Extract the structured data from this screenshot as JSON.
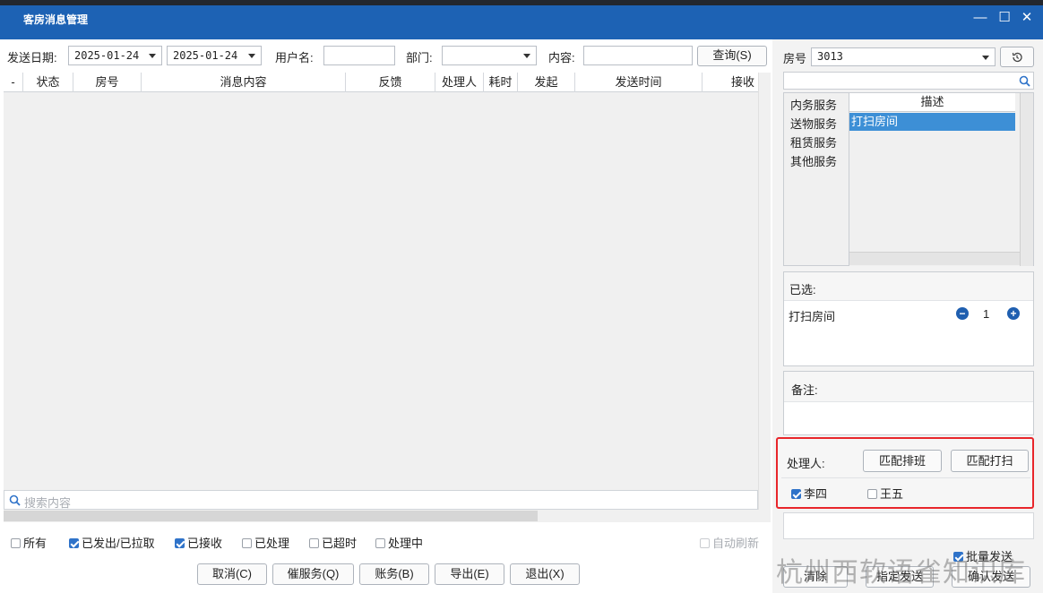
{
  "window": {
    "title": "客房消息管理",
    "minimize": "—",
    "maximize": "☐",
    "close": "✕"
  },
  "toolbar": {
    "send_date_label": "发送日期:",
    "date_from": "2025-01-24",
    "date_to": "2025-01-24",
    "username_label": "用户名:",
    "username_value": "",
    "dept_label": "部门:",
    "dept_value": "",
    "content_label": "内容:",
    "content_value": "",
    "query_button": "查询(S)"
  },
  "grid": {
    "columns": [
      "-",
      "状态",
      "房号",
      "消息内容",
      "反馈",
      "处理人",
      "耗时",
      "发起",
      "发送时间",
      "接收"
    ],
    "search_placeholder": "搜索内容"
  },
  "filters": {
    "all": "所有",
    "sent": "已发出/已拉取",
    "received": "已接收",
    "processed": "已处理",
    "timeout": "已超时",
    "processing": "处理中",
    "auto_refresh": "自动刷新"
  },
  "footer_buttons": {
    "cancel": "取消(C)",
    "urge": "催服务(Q)",
    "account": "账务(B)",
    "export": "导出(E)",
    "exit": "退出(X)"
  },
  "right": {
    "room_label": "房号",
    "room_value": "3013",
    "search_value": "",
    "categories": [
      "内务服务",
      "送物服务",
      "租赁服务",
      "其他服务"
    ],
    "desc_header": "描述",
    "desc_items": [
      "打扫房间"
    ],
    "selected_label": "已选:",
    "selected_item": "打扫房间",
    "selected_qty": "1",
    "remark_label": "备注:",
    "handler_label": "处理人:",
    "match_schedule": "匹配排班",
    "match_clean": "匹配打扫",
    "handlers": [
      {
        "name": "李四",
        "checked": true
      },
      {
        "name": "王五",
        "checked": false
      }
    ],
    "batch_send": "批量发送",
    "clear_button": "清除",
    "assign_button": "指定发送",
    "confirm_button": "确认发送"
  },
  "watermark": "杭州西软语雀知识库",
  "colors": {
    "titlebar": "#1d62b4",
    "selection": "#3d8fd6",
    "highlight_border": "#e8262b",
    "accent_icon": "#1f5fb0"
  }
}
